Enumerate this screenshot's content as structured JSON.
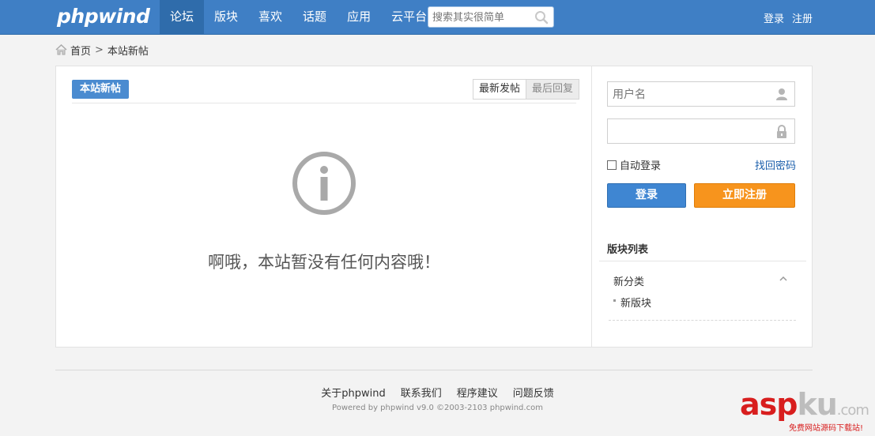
{
  "header": {
    "logo": "phpwind",
    "nav": [
      "论坛",
      "版块",
      "喜欢",
      "话题",
      "应用",
      "云平台"
    ],
    "active_nav": "论坛",
    "search_placeholder": "搜索其实很简单",
    "login": "登录",
    "register": "注册"
  },
  "breadcrumb": {
    "home": "首页",
    "separator": ">",
    "current": "本站新帖"
  },
  "content": {
    "tab_label": "本站新帖",
    "sort_latest_post": "最新发帖",
    "sort_last_reply": "最后回复",
    "empty_message": "啊哦，本站暂没有任何内容哦！"
  },
  "sidebar": {
    "username_placeholder": "用户名",
    "password_placeholder": "",
    "auto_login": "自动登录",
    "forgot_password": "找回密码",
    "login_button": "登录",
    "register_button": "立即注册",
    "board_list_title": "版块列表",
    "category": "新分类",
    "board": "新版块"
  },
  "footer": {
    "links": [
      "关于phpwind",
      "联系我们",
      "程序建议",
      "问题反馈"
    ],
    "copyright": "Powered by phpwind v9.0 ©2003-2103 phpwind.com"
  },
  "watermark": {
    "asp": "asp",
    "ku": "ku",
    "com": ".com",
    "slogan": "免费网站源码下载站!"
  },
  "colors": {
    "header_bg": "#3f7fc5",
    "nav_active_bg": "#2f6cab",
    "login_button": "#3f86d2",
    "register_button": "#f7941d",
    "tab_badge": "#4a8bd0"
  }
}
